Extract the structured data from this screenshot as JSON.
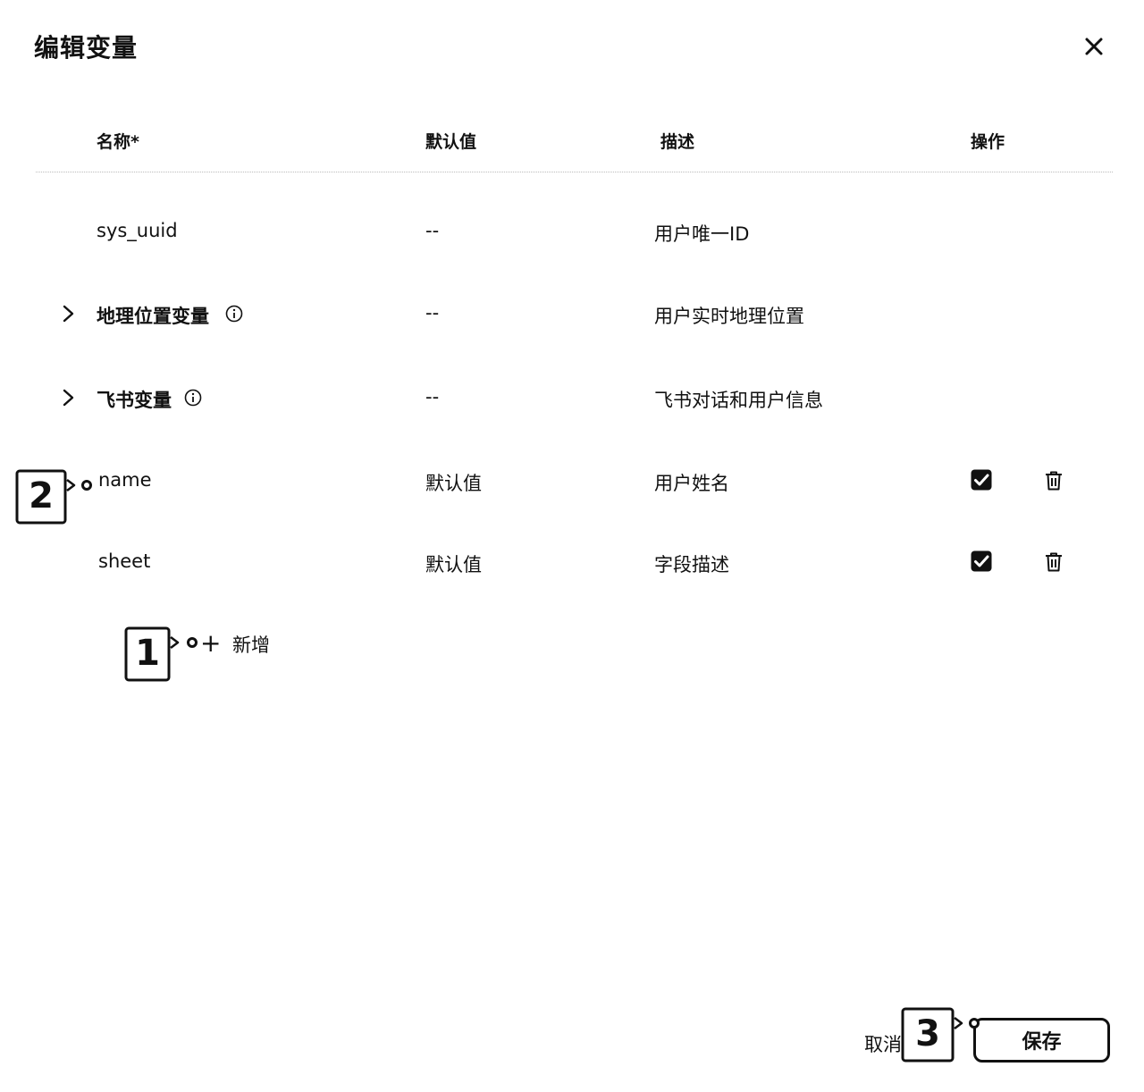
{
  "dialog": {
    "title": "编辑变量"
  },
  "columns": {
    "name": "名称*",
    "default": "默认值",
    "desc": "描述",
    "ops": "操作"
  },
  "rows": [
    {
      "name": "sys_uuid",
      "default": "--",
      "desc": "用户唯一ID"
    },
    {
      "name": "地理位置变量",
      "default": "--",
      "desc": "用户实时地理位置"
    },
    {
      "name": "飞书变量",
      "default": "--",
      "desc": "飞书对话和用户信息"
    },
    {
      "name": "name",
      "default": "默认值",
      "desc": "用户姓名"
    },
    {
      "name": "sheet",
      "default": "默认值",
      "desc": "字段描述"
    }
  ],
  "add": {
    "label": "新增"
  },
  "footer": {
    "cancel": "取消",
    "save": "保存"
  },
  "markers": [
    "1",
    "2",
    "3"
  ]
}
